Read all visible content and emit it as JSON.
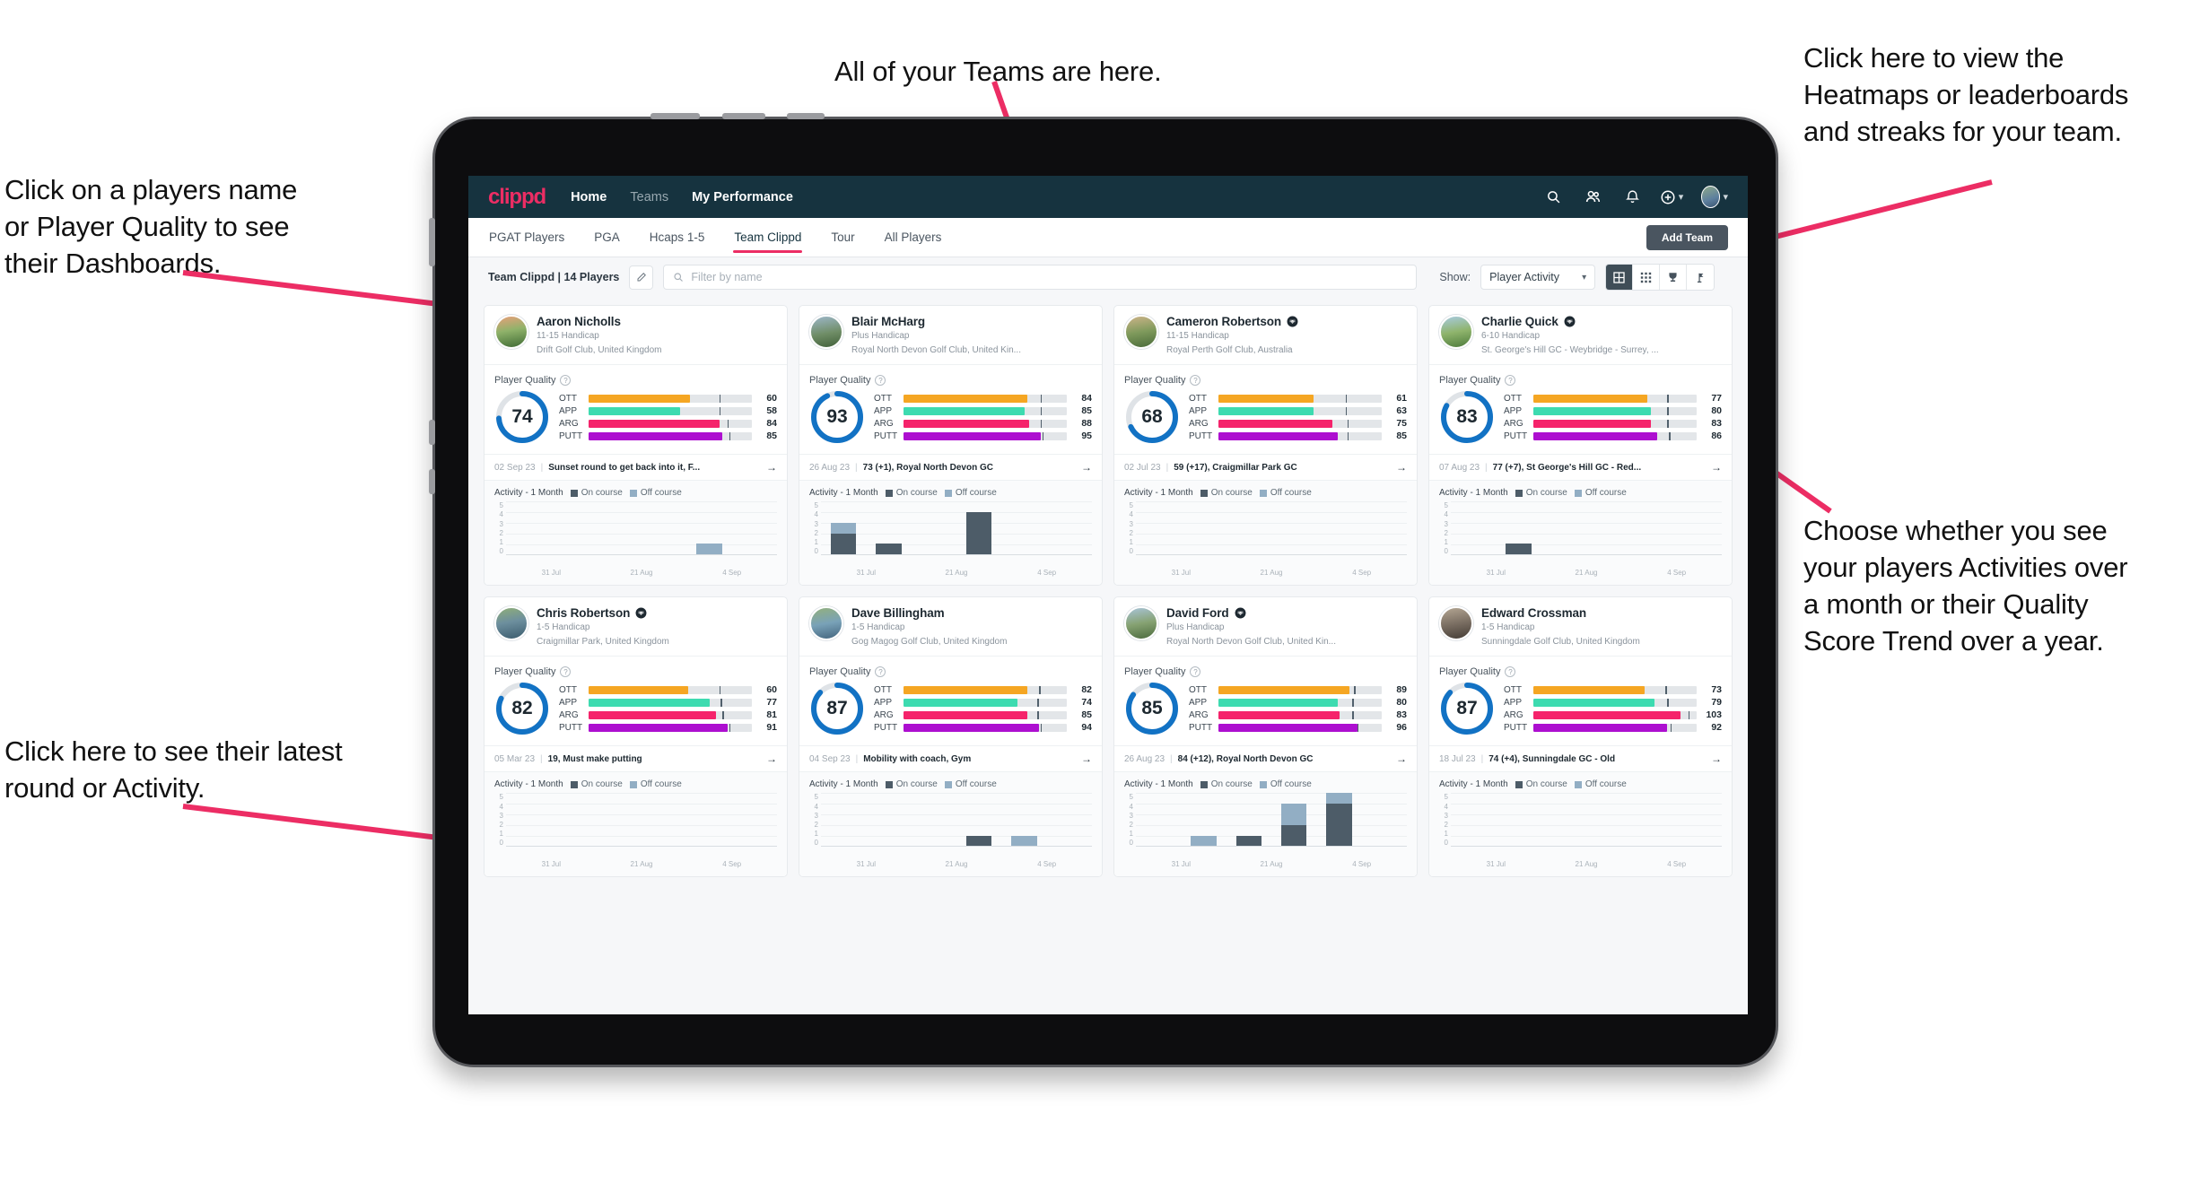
{
  "annotations": [
    {
      "id": "a-teams",
      "text": "All of your Teams are here."
    },
    {
      "id": "a-heatmaps",
      "text": "Click here to view the\nHeatmaps or leaderboards\nand streaks for your team."
    },
    {
      "id": "a-names",
      "text": "Click on a players name\nor Player Quality to see\ntheir Dashboards."
    },
    {
      "id": "a-activity",
      "text": "Choose whether you see\nyour players Activities over\na month or their Quality\nScore Trend over a year."
    },
    {
      "id": "a-latest",
      "text": "Click here to see their latest\nround or Activity."
    }
  ],
  "app": {
    "logo": "clippd",
    "nav": [
      {
        "label": "Home",
        "active": true
      },
      {
        "label": "Teams",
        "active": false
      },
      {
        "label": "My Performance",
        "active": false
      }
    ],
    "nav_icons": [
      "search-icon",
      "people-icon",
      "bell-icon",
      "plus-circle-icon",
      "avatar"
    ],
    "subtabs": [
      {
        "label": "PGAT Players",
        "active": false
      },
      {
        "label": "PGA",
        "active": false
      },
      {
        "label": "Hcaps 1-5",
        "active": false
      },
      {
        "label": "Team Clippd",
        "active": true
      },
      {
        "label": "Tour",
        "active": false
      },
      {
        "label": "All Players",
        "active": false
      }
    ],
    "add_team_label": "Add Team",
    "brand_color": "#ec2d64",
    "nav_bg": "#16333f"
  },
  "toolbar": {
    "team_label": "Team Clippd | 14 Players",
    "edit_icon": "pencil-icon",
    "search_placeholder": "Filter by name",
    "search_value": "",
    "show_label": "Show:",
    "show_value": "Player Activity",
    "views": [
      {
        "icon": "grid-large-icon",
        "active": true
      },
      {
        "icon": "grid-dense-icon",
        "active": false
      },
      {
        "icon": "trophy-icon",
        "active": false
      },
      {
        "icon": "flag-pin-icon",
        "active": false
      }
    ]
  },
  "card_labels": {
    "player_quality": "Player Quality",
    "activity": "Activity - 1 Month",
    "legend_on": "On course",
    "legend_off": "Off course",
    "metrics": [
      "OTT",
      "APP",
      "ARG",
      "PUTT"
    ],
    "x_ticks": [
      "31 Jul",
      "21 Aug",
      "4 Sep"
    ],
    "y_ticks": [
      "5",
      "4",
      "3",
      "2",
      "1",
      "0"
    ]
  },
  "metric_colors": {
    "OTT": "#f5a623",
    "APP": "#3ddbb0",
    "ARG": "#f5236b",
    "PUTT": "#ad0fd0",
    "ring": "#1272c4",
    "ring_track": "#dfe3e7"
  },
  "players": [
    {
      "name": "Aaron Nicholls",
      "verified": false,
      "handicap": "11-15 Handicap",
      "club": "Drift Golf Club, United Kingdom",
      "quality": 74,
      "avatar_gradient": "linear-gradient(170deg,#e8a07a 0%,#8fb26a 45%,#3f6b34 100%)",
      "metrics": [
        {
          "key": "OTT",
          "value": 60,
          "fill": 62,
          "mark": 80
        },
        {
          "key": "APP",
          "value": 58,
          "fill": 56,
          "mark": 80
        },
        {
          "key": "ARG",
          "value": 84,
          "fill": 80,
          "mark": 85
        },
        {
          "key": "PUTT",
          "value": 85,
          "fill": 82,
          "mark": 86
        }
      ],
      "latest_date": "02 Sep 23",
      "latest_text": "Sunset round to get back into it, F...",
      "activity": [
        {
          "on": 0,
          "off": 0
        },
        {
          "on": 0,
          "off": 0
        },
        {
          "on": 0,
          "off": 0
        },
        {
          "on": 0,
          "off": 0
        },
        {
          "on": 0,
          "off": 1
        },
        {
          "on": 0,
          "off": 0
        }
      ]
    },
    {
      "name": "Blair McHarg",
      "verified": false,
      "handicap": "Plus Handicap",
      "club": "Royal North Devon Golf Club, United Kin...",
      "quality": 93,
      "avatar_gradient": "linear-gradient(170deg,#9db7c9 0%,#6f8d66 55%,#41603a 100%)",
      "metrics": [
        {
          "key": "OTT",
          "value": 84,
          "fill": 76,
          "mark": 84
        },
        {
          "key": "APP",
          "value": 85,
          "fill": 74,
          "mark": 84
        },
        {
          "key": "ARG",
          "value": 88,
          "fill": 77,
          "mark": 84
        },
        {
          "key": "PUTT",
          "value": 95,
          "fill": 84,
          "mark": 85
        }
      ],
      "latest_date": "26 Aug 23",
      "latest_text": "73 (+1), Royal North Devon GC",
      "activity": [
        {
          "on": 2,
          "off": 1
        },
        {
          "on": 1,
          "off": 0
        },
        {
          "on": 0,
          "off": 0
        },
        {
          "on": 4,
          "off": 0
        },
        {
          "on": 0,
          "off": 0
        },
        {
          "on": 0,
          "off": 0
        }
      ]
    },
    {
      "name": "Cameron Robertson",
      "verified": true,
      "handicap": "11-15 Handicap",
      "club": "Royal Perth Golf Club, Australia",
      "quality": 68,
      "avatar_gradient": "linear-gradient(170deg,#cdb489 0%,#7f9a5c 50%,#4a6b3a 100%)",
      "metrics": [
        {
          "key": "OTT",
          "value": 61,
          "fill": 58,
          "mark": 78
        },
        {
          "key": "APP",
          "value": 63,
          "fill": 58,
          "mark": 78
        },
        {
          "key": "ARG",
          "value": 75,
          "fill": 70,
          "mark": 79
        },
        {
          "key": "PUTT",
          "value": 85,
          "fill": 73,
          "mark": 79
        }
      ],
      "latest_date": "02 Jul 23",
      "latest_text": "59 (+17), Craigmillar Park GC",
      "activity": [
        {
          "on": 0,
          "off": 0
        },
        {
          "on": 0,
          "off": 0
        },
        {
          "on": 0,
          "off": 0
        },
        {
          "on": 0,
          "off": 0
        },
        {
          "on": 0,
          "off": 0
        },
        {
          "on": 0,
          "off": 0
        }
      ]
    },
    {
      "name": "Charlie Quick",
      "verified": true,
      "handicap": "6-10 Handicap",
      "club": "St. George's Hill GC - Weybridge - Surrey, ...",
      "quality": 83,
      "avatar_gradient": "linear-gradient(170deg,#a8cbe0 0%,#8fb46c 50%,#4d7b3c 100%)",
      "metrics": [
        {
          "key": "OTT",
          "value": 77,
          "fill": 70,
          "mark": 82
        },
        {
          "key": "APP",
          "value": 80,
          "fill": 72,
          "mark": 82
        },
        {
          "key": "ARG",
          "value": 83,
          "fill": 72,
          "mark": 82
        },
        {
          "key": "PUTT",
          "value": 86,
          "fill": 76,
          "mark": 83
        }
      ],
      "latest_date": "07 Aug 23",
      "latest_text": "77 (+7), St George's Hill GC - Red...",
      "activity": [
        {
          "on": 0,
          "off": 0
        },
        {
          "on": 1,
          "off": 0
        },
        {
          "on": 0,
          "off": 0
        },
        {
          "on": 0,
          "off": 0
        },
        {
          "on": 0,
          "off": 0
        },
        {
          "on": 0,
          "off": 0
        }
      ]
    },
    {
      "name": "Chris Robertson",
      "verified": true,
      "handicap": "1-5 Handicap",
      "club": "Craigmillar Park, United Kingdom",
      "quality": 82,
      "avatar_gradient": "linear-gradient(170deg,#8fae79 0%,#6d8f9e 45%,#3b5c6e 100%)",
      "metrics": [
        {
          "key": "OTT",
          "value": 60,
          "fill": 61,
          "mark": 80
        },
        {
          "key": "APP",
          "value": 77,
          "fill": 74,
          "mark": 81
        },
        {
          "key": "ARG",
          "value": 81,
          "fill": 78,
          "mark": 82
        },
        {
          "key": "PUTT",
          "value": 91,
          "fill": 85,
          "mark": 86
        }
      ],
      "latest_date": "05 Mar 23",
      "latest_text": "19, Must make putting",
      "activity": [
        {
          "on": 0,
          "off": 0
        },
        {
          "on": 0,
          "off": 0
        },
        {
          "on": 0,
          "off": 0
        },
        {
          "on": 0,
          "off": 0
        },
        {
          "on": 0,
          "off": 0
        },
        {
          "on": 0,
          "off": 0
        }
      ]
    },
    {
      "name": "Dave Billingham",
      "verified": false,
      "handicap": "1-5 Handicap",
      "club": "Gog Magog Golf Club, United Kingdom",
      "quality": 87,
      "avatar_gradient": "linear-gradient(170deg,#93b07e 0%,#79a2b8 50%,#43657e 100%)",
      "metrics": [
        {
          "key": "OTT",
          "value": 82,
          "fill": 76,
          "mark": 83
        },
        {
          "key": "APP",
          "value": 74,
          "fill": 70,
          "mark": 82
        },
        {
          "key": "ARG",
          "value": 85,
          "fill": 76,
          "mark": 82
        },
        {
          "key": "PUTT",
          "value": 94,
          "fill": 83,
          "mark": 84
        }
      ],
      "latest_date": "04 Sep 23",
      "latest_text": "Mobility with coach, Gym",
      "activity": [
        {
          "on": 0,
          "off": 0
        },
        {
          "on": 0,
          "off": 0
        },
        {
          "on": 0,
          "off": 0
        },
        {
          "on": 1,
          "off": 0
        },
        {
          "on": 0,
          "off": 1
        },
        {
          "on": 0,
          "off": 0
        }
      ]
    },
    {
      "name": "David Ford",
      "verified": true,
      "handicap": "Plus Handicap",
      "club": "Royal North Devon Golf Club, United Kin...",
      "quality": 85,
      "avatar_gradient": "linear-gradient(170deg,#a9c4d8 0%,#86a272 50%,#4c6b3e 100%)",
      "metrics": [
        {
          "key": "OTT",
          "value": 89,
          "fill": 80,
          "mark": 83
        },
        {
          "key": "APP",
          "value": 80,
          "fill": 73,
          "mark": 82
        },
        {
          "key": "ARG",
          "value": 83,
          "fill": 74,
          "mark": 82
        },
        {
          "key": "PUTT",
          "value": 96,
          "fill": 85,
          "mark": 85
        }
      ],
      "latest_date": "26 Aug 23",
      "latest_text": "84 (+12), Royal North Devon GC",
      "activity": [
        {
          "on": 0,
          "off": 0
        },
        {
          "on": 0,
          "off": 1
        },
        {
          "on": 1,
          "off": 0
        },
        {
          "on": 2,
          "off": 2
        },
        {
          "on": 4,
          "off": 1
        },
        {
          "on": 0,
          "off": 0
        }
      ]
    },
    {
      "name": "Edward Crossman",
      "verified": false,
      "handicap": "1-5 Handicap",
      "club": "Sunningdale Golf Club, United Kingdom",
      "quality": 87,
      "avatar_gradient": "linear-gradient(170deg,#b4a693 0%,#7b6f63 50%,#443c35 100%)",
      "metrics": [
        {
          "key": "OTT",
          "value": 73,
          "fill": 68,
          "mark": 81
        },
        {
          "key": "APP",
          "value": 79,
          "fill": 74,
          "mark": 82
        },
        {
          "key": "ARG",
          "value": 103,
          "fill": 90,
          "mark": 95
        },
        {
          "key": "PUTT",
          "value": 92,
          "fill": 82,
          "mark": 84
        }
      ],
      "latest_date": "18 Jul 23",
      "latest_text": "74 (+4), Sunningdale GC - Old",
      "activity": [
        {
          "on": 0,
          "off": 0
        },
        {
          "on": 0,
          "off": 0
        },
        {
          "on": 0,
          "off": 0
        },
        {
          "on": 0,
          "off": 0
        },
        {
          "on": 0,
          "off": 0
        },
        {
          "on": 0,
          "off": 0
        }
      ]
    }
  ]
}
